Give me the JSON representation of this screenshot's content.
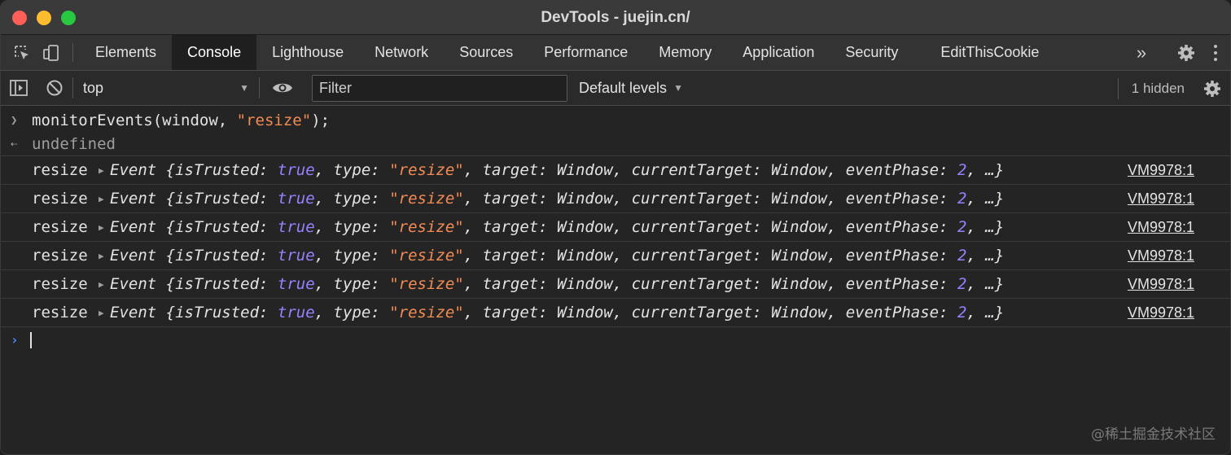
{
  "window": {
    "title": "DevTools - juejin.cn/"
  },
  "tabs": {
    "items": [
      "Elements",
      "Console",
      "Lighthouse",
      "Network",
      "Sources",
      "Performance",
      "Memory",
      "Application",
      "Security",
      "EditThisCookie"
    ],
    "active": "Console",
    "more": "»"
  },
  "toolbar": {
    "context": "top",
    "filter_placeholder": "Filter",
    "levels": "Default levels",
    "hidden": "1 hidden"
  },
  "console": {
    "command": "monitorEvents(window, \"resize\");",
    "command_parts": {
      "fn": "monitorEvents(window, ",
      "arg": "\"resize\"",
      "end": ");"
    },
    "result": "undefined",
    "logs": [
      {
        "label": "resize",
        "source": "VM9978:1"
      },
      {
        "label": "resize",
        "source": "VM9978:1"
      },
      {
        "label": "resize",
        "source": "VM9978:1"
      },
      {
        "label": "resize",
        "source": "VM9978:1"
      },
      {
        "label": "resize",
        "source": "VM9978:1"
      },
      {
        "label": "resize",
        "source": "VM9978:1"
      }
    ],
    "event_object": {
      "prefix": "Event {isTrusted: ",
      "trusted": "true",
      "type_key": ", type: ",
      "type_val": "\"resize\"",
      "rest": ", target: Window, currentTarget: Window, eventPhase: ",
      "phase": "2",
      "suffix": ", …}"
    }
  },
  "watermark": "@稀土掘金技术社区",
  "colors": {
    "keyword": "#9980ff",
    "string": "#f28b54",
    "prompt_blue": "#4d8dff"
  }
}
